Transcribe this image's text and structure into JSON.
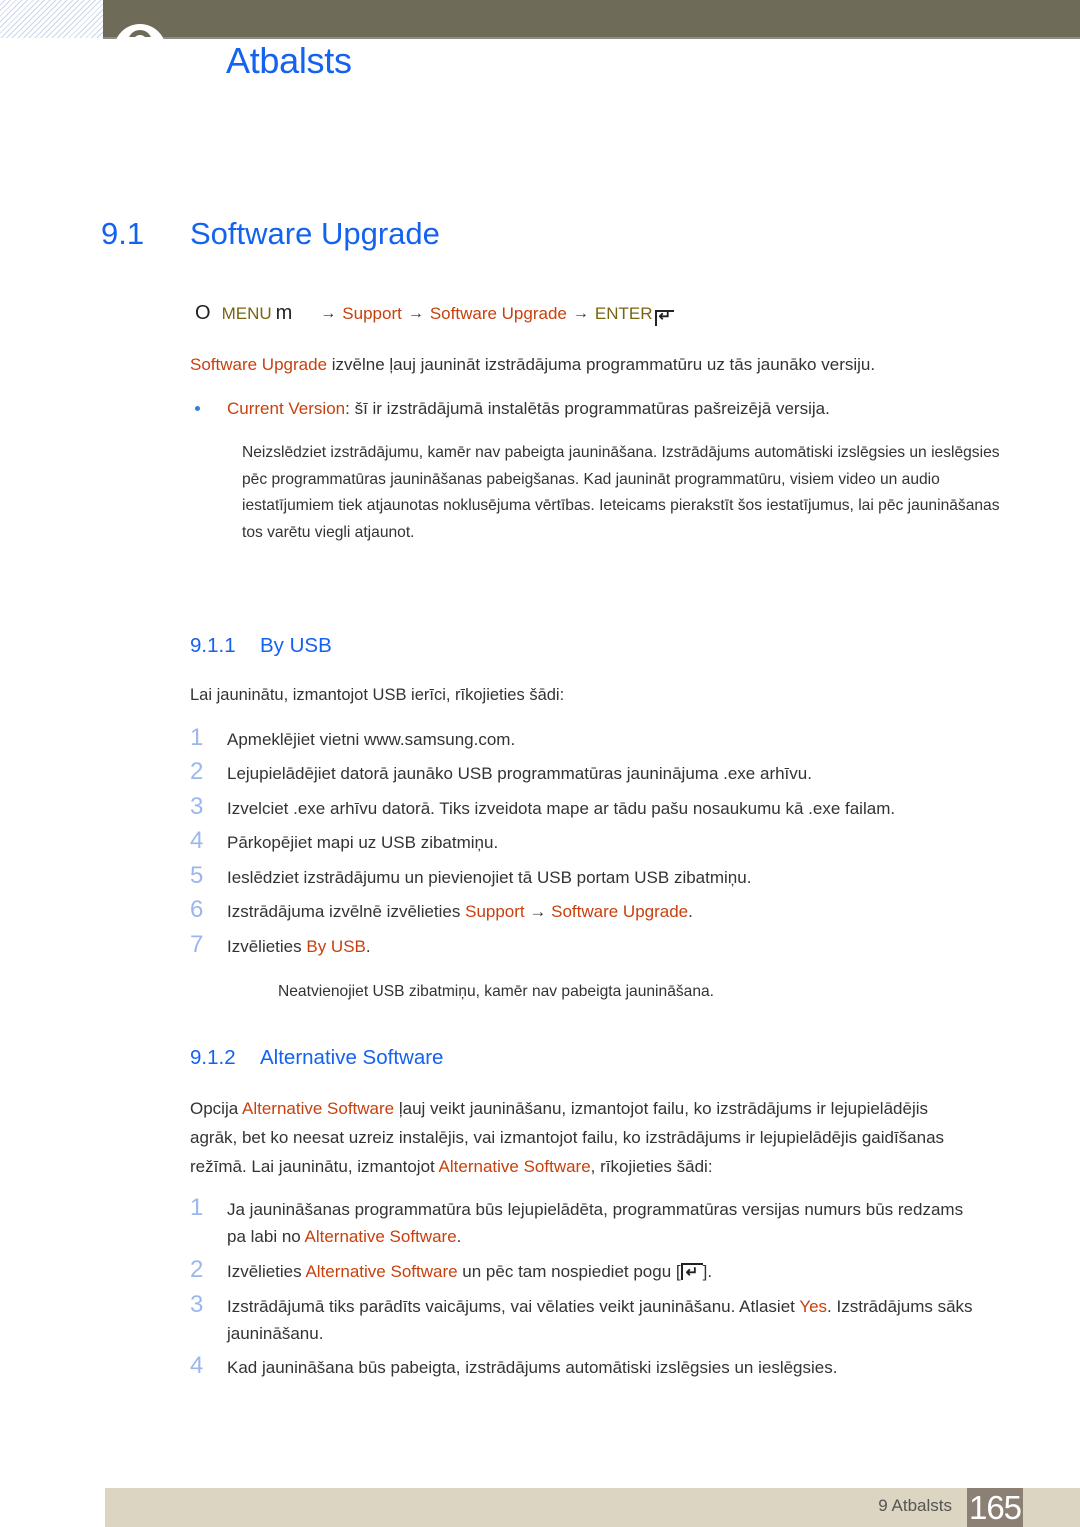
{
  "header": {
    "chapter_title": "Atbalsts",
    "bar_color": "#6e6c59"
  },
  "section": {
    "number": "9.1",
    "title": "Software Upgrade"
  },
  "menu_path": {
    "o_glyph": "O",
    "menu": "MENU",
    "m_glyph": "m",
    "arrow": "→",
    "support": "Support",
    "software_upgrade": "Software Upgrade",
    "enter": "ENTER"
  },
  "intro": {
    "highlight": "Software Upgrade",
    "text": " izvēlne ļauj jaunināt izstrādājuma programmatūru uz tās jaunāko versiju."
  },
  "bullet": {
    "highlight": "Current Version",
    "text": ": šī ir izstrādājumā instalētās programmatūras pašreizējā versija."
  },
  "note1": "Neizslēdziet izstrādājumu, kamēr nav pabeigta jaunināšana. Izstrādājums automātiski izslēgsies un ieslēgsies pēc programmatūras jaunināšanas pabeigšanas. Kad jaunināt programmatūru, visiem video un audio iestatījumiem tiek atjaunotas noklusējuma vērtības. Ieteicams pierakstīt šos iestatījumus, lai pēc jaunināšanas tos varētu viegli atjaunot.",
  "by_usb": {
    "number": "9.1.1",
    "title": "By USB",
    "intro": "Lai jauninātu, izmantojot USB ierīci, rīkojieties šādi:",
    "steps": [
      {
        "num": "1",
        "text": "Apmeklējiet vietni www.samsung.com."
      },
      {
        "num": "2",
        "text": "Lejupielādējiet datorā jaunāko USB programmatūras jauninājuma .exe arhīvu."
      },
      {
        "num": "3",
        "text": "Izvelciet .exe arhīvu datorā. Tiks izveidota mape ar tādu pašu nosaukumu kā .exe failam."
      },
      {
        "num": "4",
        "text": "Pārkopējiet mapi uz USB zibatmiņu."
      },
      {
        "num": "5",
        "text": "Ieslēdziet izstrādājumu un pievienojiet tā USB portam USB zibatmiņu."
      },
      {
        "num": "6",
        "prefix": "Izstrādājuma izvēlnē izvēlieties ",
        "hl1": "Support",
        "arrow": " → ",
        "hl2": "Software Upgrade",
        "suffix": "."
      },
      {
        "num": "7",
        "prefix": "Izvēlieties ",
        "hl1": "By USB",
        "suffix": "."
      }
    ],
    "note": "Neatvienojiet USB zibatmiņu, kamēr nav pabeigta jaunināšana."
  },
  "alt_sw": {
    "number": "9.1.2",
    "title": "Alternative Software",
    "intro_l1_prefix": "Opcija ",
    "intro_l1_hl": "Alternative Software",
    "intro_l1_suffix": " ļauj veikt jaunināšanu, izmantojot failu, ko izstrādājums ir lejupielādējis",
    "intro_l2": "agrāk, bet ko neesat uzreiz instalējis, vai izmantojot failu, ko izstrādājums ir lejupielādējis gaidīšanas",
    "intro_l3_prefix": "režīmā. Lai jauninātu, izmantojot ",
    "intro_l3_hl": "Alternative Software",
    "intro_l3_suffix": ", rīkojieties šādi:",
    "steps": [
      {
        "num": "1",
        "l1": "Ja jaunināšanas programmatūra būs lejupielādēta, programmatūras versijas numurs būs redzams",
        "l2_prefix": "pa labi no ",
        "l2_hl": "Alternative Software",
        "l2_suffix": "."
      },
      {
        "num": "2",
        "prefix": "Izvēlieties ",
        "hl": "Alternative Software",
        "mid": " un pēc tam nospiediet pogu [",
        "suffix": "]."
      },
      {
        "num": "3",
        "prefix": "Izstrādājumā tiks parādīts vaicājums, vai vēlaties veikt jaunināšanu. Atlasiet ",
        "hl": "Yes",
        "suffix": ". Izstrādājums sāks",
        "l2": "jaunināšanu."
      },
      {
        "num": "4",
        "text": "Kad jaunināšana būs pabeigta, izstrādājums automātiski izslēgsies un ieslēgsies."
      }
    ]
  },
  "footer": {
    "label": "9 Atbalsts",
    "page": "165"
  }
}
